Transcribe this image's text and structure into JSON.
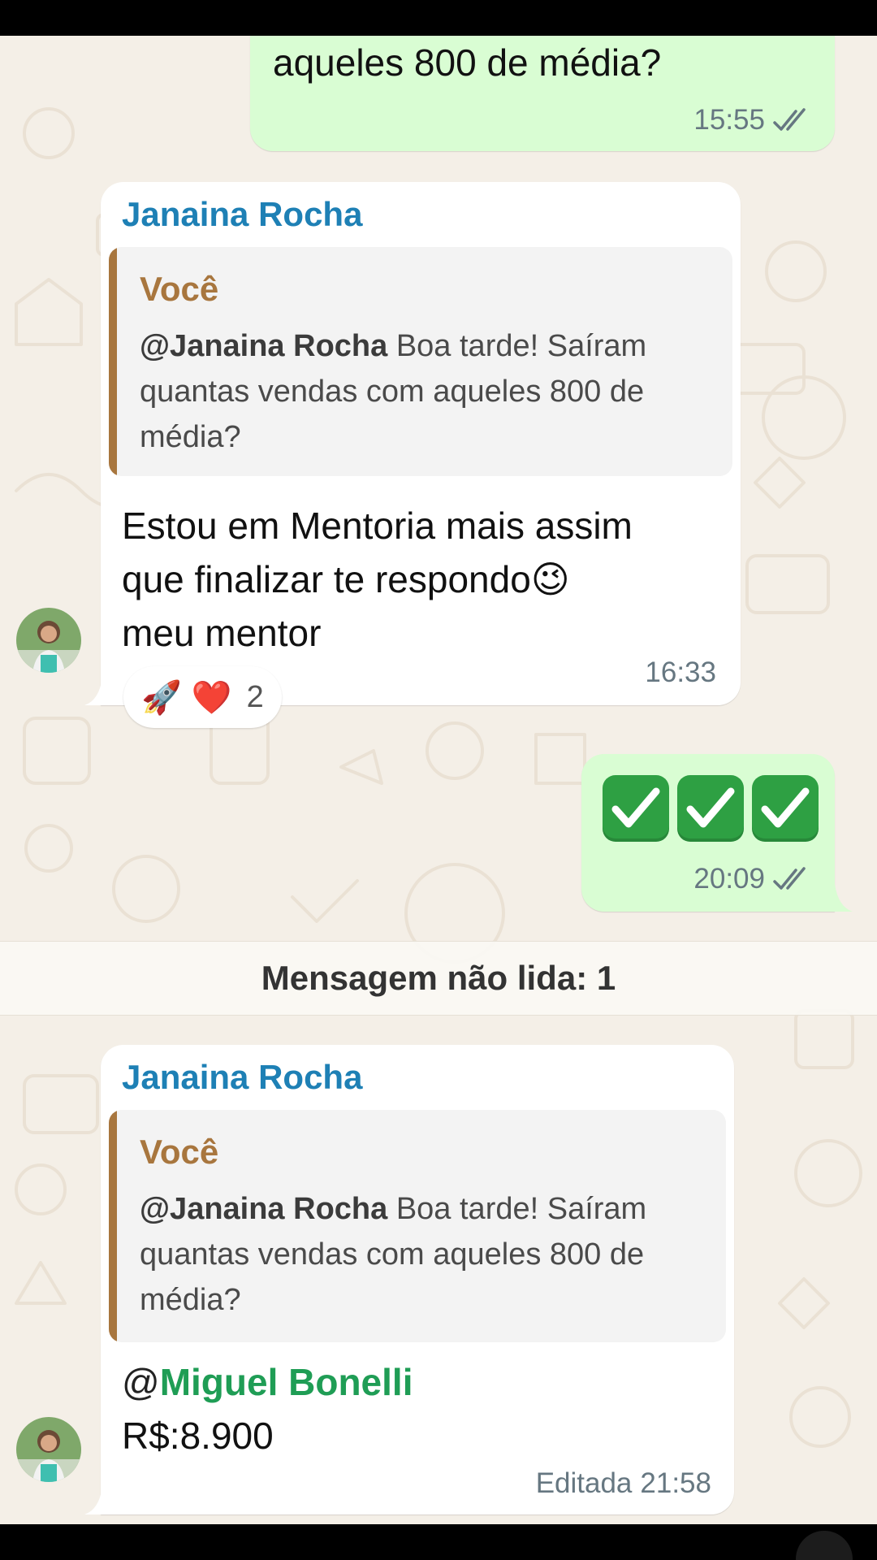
{
  "messages": [
    {
      "type": "outgoing",
      "text": "aqueles 800 de média?",
      "time": "15:55",
      "status": "read-check-icon"
    },
    {
      "type": "incoming",
      "sender": "Janaina Rocha",
      "quote_author": "Você",
      "quote_mention": "@Janaina Rocha",
      "quote_text": "Boa tarde! Saíram quantas vendas com aqueles 800 de média?",
      "text_line1": "Estou em Mentoria  mais assim",
      "text_line2": "que finalizar te respondo😉",
      "text_line3": "meu mentor",
      "time": "16:33",
      "reactions": {
        "emoji1": "🚀",
        "emoji2": "❤️",
        "count": "2"
      }
    },
    {
      "type": "outgoing",
      "text": "✅✅✅",
      "time": "20:09",
      "status": "read-check-icon"
    },
    {
      "type": "incoming",
      "sender": "Janaina Rocha",
      "quote_author": "Você",
      "quote_mention": "@Janaina Rocha",
      "quote_text": "Boa tarde! Saíram quantas vendas com aqueles 800 de média?",
      "mention_at": "@",
      "mention_name": "Miguel Bonelli",
      "text": "R$:8.900",
      "edited_label": "Editada",
      "time": "21:58"
    }
  ],
  "unread_divider": "Mensagem não lida: 1",
  "colors": {
    "outgoing_bubble": "#d9fdd3",
    "incoming_bubble": "#ffffff",
    "sender_name": "#1e80b5",
    "quote_accent": "#a8763e",
    "mention_green": "#1f9d55",
    "chat_background": "#f4efe7"
  }
}
